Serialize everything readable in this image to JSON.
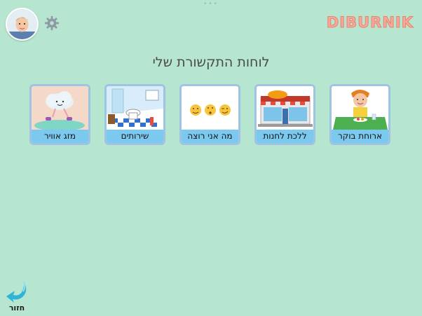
{
  "app": {
    "logo_text": "DIBURNIK"
  },
  "page": {
    "title": "לוחות התקשורת שלי"
  },
  "boards": [
    {
      "label": "מזג אוויר",
      "image": "weather-cloud-image"
    },
    {
      "label": "שירותים",
      "image": "bathroom-image"
    },
    {
      "label": "מה אני רוצה",
      "image": "emoji-faces-image"
    },
    {
      "label": "ללכת לחנות",
      "image": "store-image"
    },
    {
      "label": "ארוחת בוקר",
      "image": "breakfast-boy-image"
    }
  ],
  "nav": {
    "back_label": "חזור"
  },
  "colors": {
    "background": "#b6e6d0",
    "card_border": "#9fc3e2",
    "label_bg": "#7cc9f0",
    "logo": "#f6a99a"
  }
}
